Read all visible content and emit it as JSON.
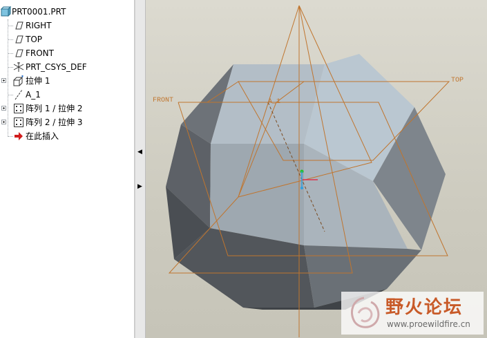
{
  "model_tree": {
    "items": [
      {
        "label": "PRT0001.PRT",
        "icon": "part-icon",
        "expandable": false
      },
      {
        "label": "RIGHT",
        "icon": "datum-plane-icon",
        "expandable": false
      },
      {
        "label": "TOP",
        "icon": "datum-plane-icon",
        "expandable": false
      },
      {
        "label": "FRONT",
        "icon": "datum-plane-icon",
        "expandable": false
      },
      {
        "label": "PRT_CSYS_DEF",
        "icon": "coordinate-system-icon",
        "expandable": false
      },
      {
        "label": "拉伸 1",
        "icon": "extrude-icon",
        "expandable": true
      },
      {
        "label": "A_1",
        "icon": "datum-axis-icon",
        "expandable": false
      },
      {
        "label": "阵列 1 / 拉伸 2",
        "icon": "pattern-icon",
        "expandable": true
      },
      {
        "label": "阵列 2 / 拉伸 3",
        "icon": "pattern-icon",
        "expandable": true
      },
      {
        "label": "在此插入",
        "icon": "insert-here-arrow-icon",
        "expandable": false
      }
    ]
  },
  "viewport": {
    "datum_labels": {
      "top": "TOP",
      "front": "FRONT",
      "axis": "A_1"
    },
    "colors": {
      "datum": "#c0752e",
      "background": "#d6d4c9"
    }
  },
  "watermark": {
    "title": "野火论坛",
    "url": "www.proewildfire.cn"
  }
}
